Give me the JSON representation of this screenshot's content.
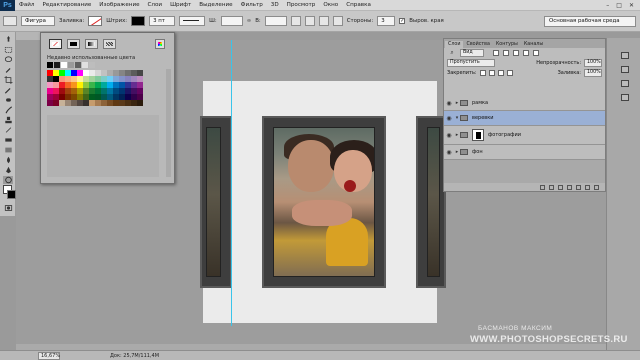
{
  "app": {
    "logo": "Ps"
  },
  "menu": [
    "Файл",
    "Редактирование",
    "Изображение",
    "Слои",
    "Шрифт",
    "Выделение",
    "Фильтр",
    "3D",
    "Просмотр",
    "Окно",
    "Справка"
  ],
  "window_controls": {
    "minimize": "–",
    "maximize": "□",
    "close": "✕"
  },
  "options": {
    "tool_mode": "Фигура",
    "fill_label": "Заливка:",
    "stroke_label": "Штрих:",
    "stroke_width": "3 пт",
    "w_label": "Ш:",
    "h_label": "В:",
    "sides_label": "Стороны:",
    "sides_value": "3",
    "align_edges_label": "Выров. края",
    "align_edges_checked": true,
    "workspace": "Основная рабочая среда"
  },
  "swatches": {
    "recent_label": "Недавно использованные цвета",
    "recent": [
      "#000000",
      "#1a1a1a",
      "#ffffff",
      "#9a9a9a",
      "#606060",
      "#e0e0e0",
      "#bdbdbd"
    ],
    "grid": [
      "#ff0000",
      "#ffff00",
      "#00ff00",
      "#00ffff",
      "#0000ff",
      "#ff00ff",
      "#ffffff",
      "#ebebeb",
      "#d6d6d6",
      "#c2c2c2",
      "#adadad",
      "#999999",
      "#858585",
      "#707070",
      "#5c5c5c",
      "#474747",
      "#333333",
      "#000000",
      "#f7977a",
      "#f9ad81",
      "#fdc68a",
      "#fff79a",
      "#c4df9b",
      "#a2d39c",
      "#82ca9d",
      "#7bcdc8",
      "#6ecff6",
      "#7ea7d8",
      "#8493ca",
      "#8882be",
      "#a187be",
      "#bc8dbf",
      "#f49ac2",
      "#f6989d",
      "#ed1c24",
      "#f26522",
      "#f7941d",
      "#fff200",
      "#8dc73f",
      "#39b54a",
      "#00a651",
      "#00a99d",
      "#00aeef",
      "#0072bc",
      "#0054a6",
      "#2e3192",
      "#662d91",
      "#92278f",
      "#ec008c",
      "#ed145b",
      "#9e0b0f",
      "#a0410d",
      "#a36209",
      "#aba000",
      "#598527",
      "#1a7b30",
      "#007236",
      "#00746b",
      "#0076a3",
      "#004b80",
      "#003471",
      "#1b1464",
      "#440e62",
      "#630460",
      "#9e005d",
      "#9e0039",
      "#790000",
      "#7b2e00",
      "#7d4900",
      "#827b00",
      "#406618",
      "#005e20",
      "#005826",
      "#005952",
      "#005b7f",
      "#003663",
      "#002157",
      "#0d004c",
      "#32004b",
      "#4b0049",
      "#7b0046",
      "#7a0026",
      "#c7b299",
      "#998675",
      "#736357",
      "#534741",
      "#37302d",
      "#c69c6d",
      "#a67c52",
      "#8c6239",
      "#754c24",
      "#603913",
      "#5b3a1a",
      "#4a2f14",
      "#3a2510",
      "#2b1b0c"
    ]
  },
  "layers_panel": {
    "tabs": [
      "Слои",
      "Свойства",
      "Контуры",
      "Каналы"
    ],
    "active_tab": "Слои",
    "kind_filter": "Вид",
    "blend_mode": "Пропустить",
    "opacity_label": "Непрозрачность:",
    "opacity": "100%",
    "lock_label": "Закрепить:",
    "fill_label": "Заливка:",
    "fill": "100%",
    "layers": [
      {
        "name": "рамка",
        "type": "group",
        "visible": true,
        "expanded": false,
        "selected": false
      },
      {
        "name": "веревки",
        "type": "group",
        "visible": true,
        "expanded": true,
        "selected": true
      },
      {
        "name": "фотографии",
        "type": "group",
        "visible": true,
        "expanded": false,
        "selected": false
      },
      {
        "name": "фон",
        "type": "group",
        "visible": true,
        "expanded": false,
        "selected": false
      }
    ]
  },
  "status": {
    "zoom": "16,67%",
    "doc_size": "Док: 25,7М/111,4М"
  },
  "watermark": {
    "author": "БАСМАНОВ МАКСИМ",
    "site": "WWW.PHOTOSHOPSECRETS.RU"
  }
}
